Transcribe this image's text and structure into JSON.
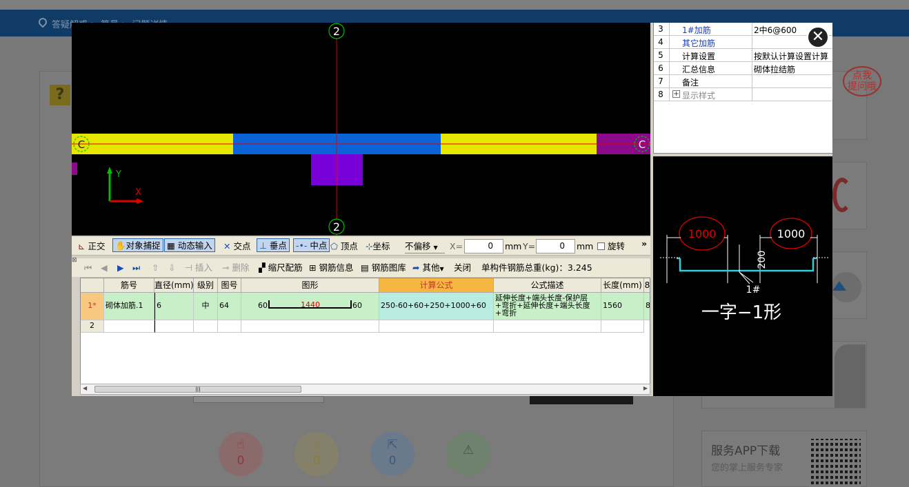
{
  "bg": {
    "breadcrumb": "答疑解惑 > 算量 > 问题详情",
    "ask_btn": "点我\n提问哦",
    "like_count": "0",
    "fav_count": "0",
    "share_count": "0",
    "app_title": "服务APP下载",
    "app_sub": "您的掌上服务专家"
  },
  "props": {
    "rows": [
      {
        "n": "3",
        "k": "1#加筋",
        "v": "2中6@600",
        "blue": true
      },
      {
        "n": "4",
        "k": "其它加筋",
        "v": "",
        "blue": true
      },
      {
        "n": "5",
        "k": "计算设置",
        "v": "按默认计算设置计算"
      },
      {
        "n": "6",
        "k": "汇总信息",
        "v": "砌体拉结筋"
      },
      {
        "n": "7",
        "k": "备注",
        "v": ""
      },
      {
        "n": "8",
        "k": "显示样式",
        "v": "",
        "expand": true
      }
    ]
  },
  "canvas": {
    "axis_top": "2",
    "axis_bottom": "2",
    "axis_left": "C",
    "axis_right": "C",
    "y_label": "Y",
    "x_label": "X"
  },
  "preview": {
    "dim_left": "1000",
    "dim_right": "1000",
    "dim_height": "200",
    "rebar_mark": "1#",
    "shape_name": "一字−1形"
  },
  "toolbar1": {
    "ortho": "正交",
    "snap": "对象捕捉",
    "dynamic": "动态输入",
    "intersection": "交点",
    "perpendicular": "垂点",
    "midpoint": "中点",
    "vertex": "顶点",
    "coordinate": "坐标",
    "offset": "不偏移",
    "x_label": "X=",
    "x_value": "0",
    "x_unit": "mm",
    "y_label": "Y=",
    "y_value": "0",
    "y_unit": "mm",
    "rotate": "旋转",
    "more": "»"
  },
  "toolbar2": {
    "insert": "插入",
    "delete": "删除",
    "scale": "缩尺配筋",
    "info": "钢筋信息",
    "library": "钢筋图库",
    "other": "其他",
    "close": "关闭",
    "total": "单构件钢筋总重(kg)：3.245"
  },
  "grid": {
    "headers": [
      "筋号",
      "直径(mm)",
      "级别",
      "图号",
      "图形",
      "计算公式",
      "公式描述",
      "长度(mm)",
      "8"
    ],
    "row1": {
      "idx": "1*",
      "name": "砌体加筋.1",
      "dia": "6",
      "grade": "中",
      "fig": "64",
      "shape_left": "60",
      "shape_mid": "1440",
      "shape_right": "60",
      "formula": "250-60+60+250+1000+60",
      "desc": "延伸长度+端头长度-保护层+弯折+延伸长度+端头长度+弯折",
      "length": "1560",
      "extra": "8"
    },
    "row2": {
      "idx": "2"
    }
  },
  "colors": {
    "yellow_beam": "#e6e600",
    "blue_beam": "#0a64d8",
    "purple": "#7a00d8",
    "magenta": "#8a0a8a",
    "axis_red": "#e00000",
    "axis_green": "#00c000",
    "formula_header": "#f5b642",
    "row_green": "#c8f0c8"
  }
}
